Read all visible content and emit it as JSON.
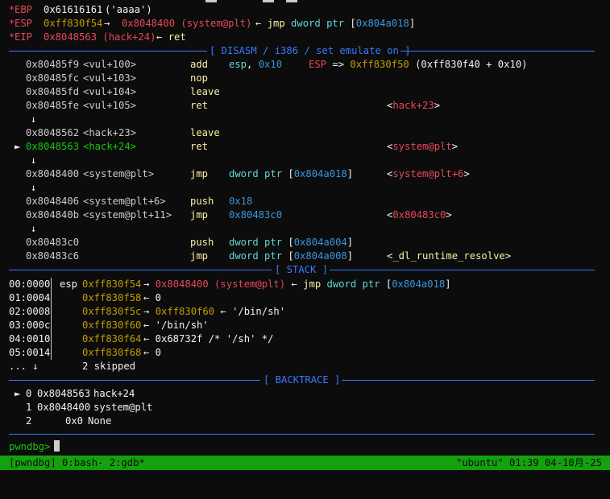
{
  "registers": [
    {
      "star": "*",
      "name": "EBP",
      "value": "0x61616161",
      "rest": "('aaaa')"
    },
    {
      "star": "*",
      "name": "ESP",
      "value": "0xff830f54",
      "arrow": "→",
      "target": "0x8048400 (system@plt)",
      "tail": "← jmp dword ptr [0x804a018]"
    },
    {
      "star": "*",
      "name": "EIP",
      "value": "0x8048563 (hack+24)",
      "tail": "← ret"
    }
  ],
  "disasm_header": "[ DISASM / i386 / set emulate on ]",
  "disasm": [
    {
      "marker": "",
      "addr": "0x80485f9",
      "sym": "<vul+100>",
      "op": "add",
      "args": "esp, 0x10",
      "note": "ESP => 0xff830f50 (0xff830f40 + 0x10)"
    },
    {
      "marker": "",
      "addr": "0x80485fc",
      "sym": "<vul+103>",
      "op": "nop",
      "args": "",
      "note": ""
    },
    {
      "marker": "",
      "addr": "0x80485fd",
      "sym": "<vul+104>",
      "op": "leave",
      "args": "",
      "note": ""
    },
    {
      "marker": "",
      "addr": "0x80485fe",
      "sym": "<vul+105>",
      "op": "ret",
      "args": "",
      "note": "<hack+23>"
    },
    {
      "marker": "↓"
    },
    {
      "marker": "",
      "addr": "0x8048562",
      "sym": "<hack+23>",
      "op": "leave",
      "args": "",
      "note": ""
    },
    {
      "marker": "►",
      "addr": "0x8048563",
      "sym": "<hack+24>",
      "op": "ret",
      "args": "",
      "note": "<system@plt>"
    },
    {
      "marker": "↓"
    },
    {
      "marker": "",
      "addr": "0x8048400",
      "sym": "<system@plt>",
      "op": "jmp",
      "args": "dword ptr [0x804a018]",
      "note": "<system@plt+6>"
    },
    {
      "marker": "↓"
    },
    {
      "marker": "",
      "addr": "0x8048406",
      "sym": "<system@plt+6>",
      "op": "push",
      "args": "0x18",
      "note": ""
    },
    {
      "marker": "",
      "addr": "0x804840b",
      "sym": "<system@plt+11>",
      "op": "jmp",
      "args": "0x80483c0",
      "note": "<0x80483c0>"
    },
    {
      "marker": "↓"
    },
    {
      "marker": "",
      "addr": "0x80483c0",
      "sym": "",
      "op": "push",
      "args": "dword ptr [0x804a004]",
      "note": ""
    },
    {
      "marker": "",
      "addr": "0x80483c6",
      "sym": "",
      "op": "jmp",
      "args": "dword ptr [0x804a008]",
      "note": "<_dl_runtime_resolve>"
    }
  ],
  "stack_header": "[ STACK ]",
  "stack": [
    {
      "idx": "00:0000",
      "reg": "esp",
      "addr": "0xff830f54",
      "text": "→ 0x8048400 (system@plt) ← jmp dword ptr [0x804a018]"
    },
    {
      "idx": "01:0004",
      "reg": "",
      "addr": "0xff830f58",
      "text": "← 0"
    },
    {
      "idx": "02:0008",
      "reg": "",
      "addr": "0xff830f5c",
      "text": "→ 0xff830f60 ← '/bin/sh'"
    },
    {
      "idx": "03:000c",
      "reg": "",
      "addr": "0xff830f60",
      "text": "← '/bin/sh'"
    },
    {
      "idx": "04:0010",
      "reg": "",
      "addr": "0xff830f64",
      "text": "← 0x68732f /* '/sh' */"
    },
    {
      "idx": "05:0014",
      "reg": "",
      "addr": "0xff830f68",
      "text": "← 0"
    },
    {
      "idx": "... ↓",
      "reg": "",
      "addr": "",
      "text": "2 skipped"
    }
  ],
  "backtrace_header": "[ BACKTRACE ]",
  "backtrace": [
    {
      "marker": "►",
      "frame": "0",
      "addr": "0x8048563",
      "sym": "hack+24"
    },
    {
      "marker": "",
      "frame": "1",
      "addr": "0x8048400",
      "sym": "system@plt"
    },
    {
      "marker": "",
      "frame": "2",
      "addr": "0x0",
      "sym": "None"
    }
  ],
  "prompt": "pwndbg>",
  "status": {
    "left": "[pwndbg] 0:bash- 2:gdb*",
    "right": "\"ubuntu\" 01:39 04-10月-25"
  },
  "colors": {
    "accent": "#3b78ff",
    "register": "#e74856",
    "status_bg": "#13a10e"
  }
}
